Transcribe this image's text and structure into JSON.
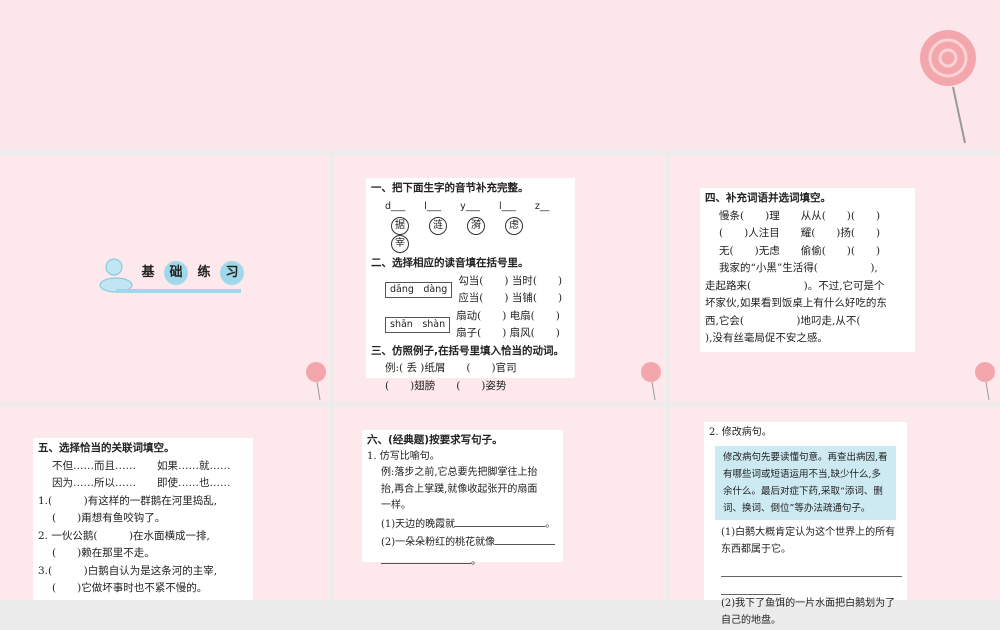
{
  "logo": {
    "chars": [
      "基",
      "础",
      "练",
      "习"
    ]
  },
  "q1": {
    "title": "一、把下面生字的音节补充完整。",
    "syllables": "d___　　l___　　y___　　l___　　z__",
    "chars": [
      "据",
      "涟",
      "漪",
      "虑",
      "宰"
    ]
  },
  "q2": {
    "title": "二、选择相应的读音填在括号里。",
    "pinyin1": "dāng　dàng",
    "pinyin2": "shān　shàn",
    "rows": [
      "勾当(　　) 当时(　　)",
      "应当(　　) 当铺(　　)",
      "扇动(　　) 电扇(　　)",
      "扇子(　　) 扇风(　　)"
    ]
  },
  "q3": {
    "title": "三、仿照例子,在括号里填入恰当的动词。",
    "lines": [
      "例:( 丢 )纸屑　　(　　)官司",
      "(　　)翅膀　　(　　)姿势"
    ]
  },
  "q4": {
    "title": "四、补充词语并选词填空。",
    "words": [
      "慢条(　　)理　　从从(　　)(　　)",
      "(　　)人注目　　耀(　　)扬(　　)",
      "无(　　)无虑　　偷偷(　　)(　　)"
    ],
    "para": [
      "我家的“小黑”生活得(　　　　　),",
      "走起路来(　　　　　)。不过,它可是个",
      "坏家伙,如果看到饭桌上有什么好吃的东",
      "西,它会(　　　　　)地叼走,从不(",
      "),没有丝毫局促不安之感。"
    ]
  },
  "q5": {
    "title": "五、选择恰当的关联词填空。",
    "options": [
      "不但……而且……　　如果……就……",
      "因为……所以……　　即使……也……"
    ],
    "items": [
      "1.(　　　)有这样的一群鹅在河里捣乱,",
      "(　　)甭想有鱼咬钩了。",
      "2. 一伙公鹅(　　　)在水面横成一排,",
      "(　　)赖在那里不走。",
      "3.(　　　)白鹅自认为是这条河的主宰,",
      "(　　)它做坏事时也不紧不慢的。"
    ]
  },
  "q6": {
    "title": "六、(经典题)按要求写句子。",
    "sub": "1. 仿写比喻句。",
    "example": [
      "例:落步之前,它总要先把脚掌往上抬",
      "抬,再合上掌蹼,就像收起张开的扇面",
      "一样。"
    ],
    "items": [
      "(1)天边的晚霞就",
      "(2)一朵朵粉红的桃花就像"
    ]
  },
  "q7": {
    "sub": "2. 修改病句。",
    "tip": "修改病句先要读懂句意。再查出病因,看有哪些词或短语运用不当,缺少什么,多余什么。最后对症下药,采取“添词、删词、换词、倒位”等办法疏通句子。",
    "items": [
      "(1)白鹅大概肯定认为这个世界上的所有东西都属于它。",
      "(2)我下了鱼饵的一片水面把白鹅划为了自己的地盘。"
    ]
  }
}
